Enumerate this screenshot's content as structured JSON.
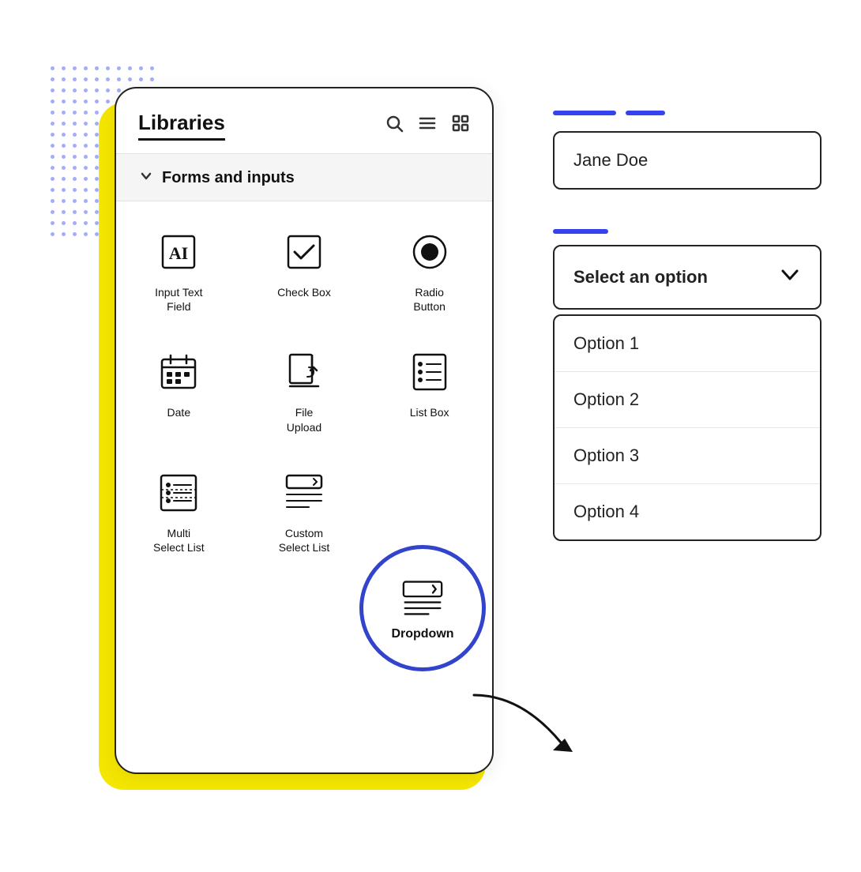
{
  "panel": {
    "title": "Libraries",
    "section": {
      "title": "Forms and inputs"
    },
    "items": [
      {
        "id": "input-text-field",
        "label": "Input Text\nField",
        "icon": "ai-text"
      },
      {
        "id": "check-box",
        "label": "Check Box",
        "icon": "checkbox"
      },
      {
        "id": "radio-button",
        "label": "Radio\nButton",
        "icon": "radio"
      },
      {
        "id": "date",
        "label": "Date",
        "icon": "date"
      },
      {
        "id": "file-upload",
        "label": "File\nUpload",
        "icon": "file-upload"
      },
      {
        "id": "list-box",
        "label": "List Box",
        "icon": "list-box"
      },
      {
        "id": "multi-select-list",
        "label": "Multi\nSelect List",
        "icon": "multi-select"
      },
      {
        "id": "custom-select-list",
        "label": "Custom\nSelect List",
        "icon": "custom-select"
      },
      {
        "id": "dropdown",
        "label": "Dropdown",
        "icon": "dropdown"
      }
    ]
  },
  "right": {
    "text_input_value": "Jane Doe",
    "select_placeholder": "Select an option",
    "options": [
      {
        "label": "Option 1"
      },
      {
        "label": "Option 2"
      },
      {
        "label": "Option 3"
      },
      {
        "label": "Option 4"
      }
    ]
  },
  "icons": {
    "search": "🔍",
    "list": "☰",
    "grid": "⊞",
    "chevron_down": "›",
    "chevron_down_bold": "⌄"
  }
}
